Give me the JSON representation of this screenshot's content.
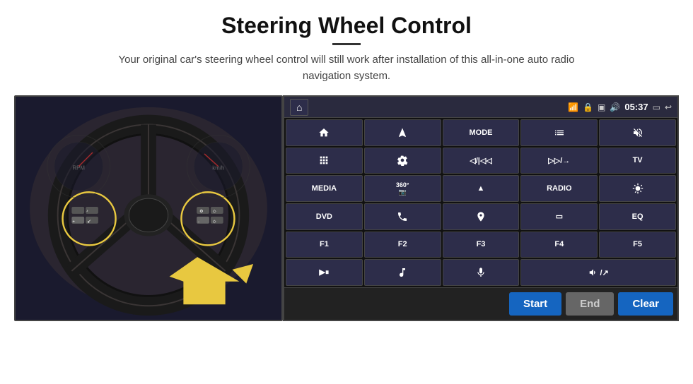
{
  "page": {
    "title": "Steering Wheel Control",
    "subtitle": "Your original car's steering wheel control will still work after installation of this all-in-one auto radio navigation system."
  },
  "status_bar": {
    "time": "05:37",
    "icons": [
      "wifi",
      "lock",
      "sim",
      "bluetooth",
      "screen",
      "back"
    ]
  },
  "grid_buttons": [
    {
      "id": "home",
      "label": "⌂",
      "type": "icon"
    },
    {
      "id": "nav",
      "label": "▷",
      "type": "icon"
    },
    {
      "id": "mode",
      "label": "MODE",
      "type": "text"
    },
    {
      "id": "list",
      "label": "≡",
      "type": "icon"
    },
    {
      "id": "mute",
      "label": "🔇",
      "type": "icon"
    },
    {
      "id": "apps",
      "label": "⋯",
      "type": "icon"
    },
    {
      "id": "settings",
      "label": "⚙",
      "type": "icon"
    },
    {
      "id": "prev",
      "label": "◀/|◀◀",
      "type": "text"
    },
    {
      "id": "next",
      "label": "▶▶/→",
      "type": "text"
    },
    {
      "id": "tv",
      "label": "TV",
      "type": "text"
    },
    {
      "id": "media",
      "label": "MEDIA",
      "type": "text"
    },
    {
      "id": "360cam",
      "label": "360°",
      "type": "icon"
    },
    {
      "id": "eject",
      "label": "▲",
      "type": "icon"
    },
    {
      "id": "radio",
      "label": "RADIO",
      "type": "text"
    },
    {
      "id": "brightness",
      "label": "☀",
      "type": "icon"
    },
    {
      "id": "dvd",
      "label": "DVD",
      "type": "text"
    },
    {
      "id": "phone",
      "label": "📞",
      "type": "icon"
    },
    {
      "id": "navi",
      "label": "◎",
      "type": "icon"
    },
    {
      "id": "screen2",
      "label": "▭",
      "type": "icon"
    },
    {
      "id": "eq",
      "label": "EQ",
      "type": "text"
    },
    {
      "id": "f1",
      "label": "F1",
      "type": "text"
    },
    {
      "id": "f2",
      "label": "F2",
      "type": "text"
    },
    {
      "id": "f3",
      "label": "F3",
      "type": "text"
    },
    {
      "id": "f4",
      "label": "F4",
      "type": "text"
    },
    {
      "id": "f5",
      "label": "F5",
      "type": "text"
    },
    {
      "id": "play-pause",
      "label": "▶⏸",
      "type": "icon"
    },
    {
      "id": "music",
      "label": "♫",
      "type": "icon"
    },
    {
      "id": "mic",
      "label": "🎤",
      "type": "icon"
    },
    {
      "id": "vol-call",
      "label": "🔈/↗",
      "type": "icon"
    }
  ],
  "bottom_buttons": {
    "start_label": "Start",
    "end_label": "End",
    "clear_label": "Clear"
  }
}
